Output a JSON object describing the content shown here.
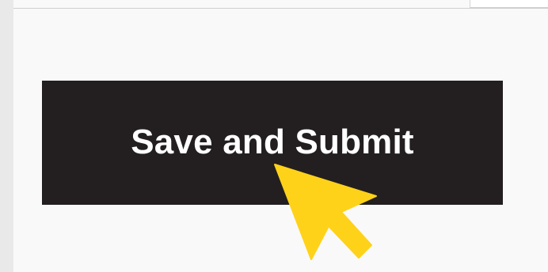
{
  "button": {
    "label": "Save and Submit",
    "background_color": "#231f20",
    "text_color": "#ffffff"
  },
  "cursor": {
    "icon": "arrow-pointer-icon",
    "color": "#ffd21a"
  }
}
